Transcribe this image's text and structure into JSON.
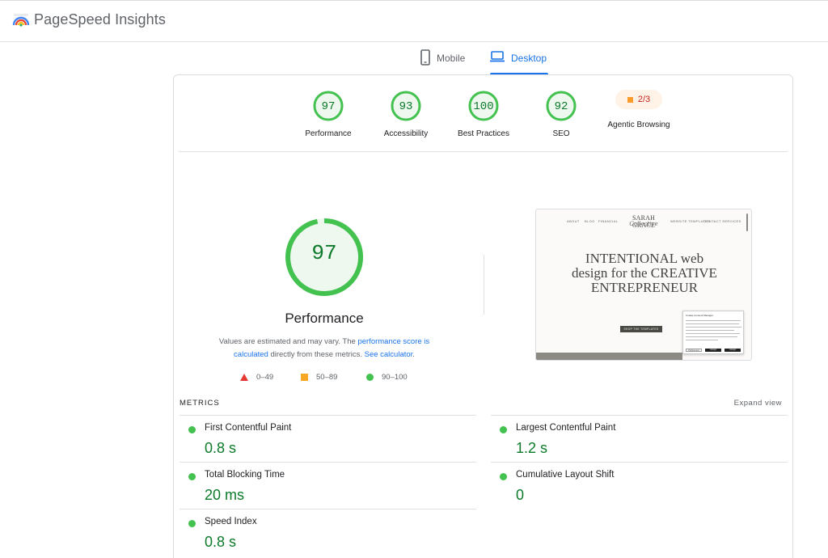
{
  "app": {
    "title": "PageSpeed Insights"
  },
  "tabs": [
    {
      "label": "Mobile",
      "icon": "phone-icon",
      "active": false
    },
    {
      "label": "Desktop",
      "icon": "laptop-icon",
      "active": true
    }
  ],
  "categories": [
    {
      "label": "Performance",
      "score": "97"
    },
    {
      "label": "Accessibility",
      "score": "93"
    },
    {
      "label": "Best Practices",
      "score": "100"
    },
    {
      "label": "SEO",
      "score": "92"
    },
    {
      "label": "Agentic Browsing",
      "score": "2/3"
    }
  ],
  "main": {
    "score": "97",
    "title": "Performance",
    "note_1": "Values are estimated and may vary. The ",
    "note_link_1": "performance score is calculated",
    "note_2": " directly from these metrics. ",
    "note_link_2": "See calculator",
    "note_3": "."
  },
  "legend": [
    {
      "range": "0–49",
      "shape": "triangle",
      "color": "#e53935"
    },
    {
      "range": "50–89",
      "shape": "square",
      "color": "#f9a825"
    },
    {
      "range": "90–100",
      "shape": "circle",
      "color": "#43c24f"
    }
  ],
  "screenshot": {
    "nav": [
      "ABOUT",
      "BLOG",
      "FINANCIAL",
      "WEBSITE TEMPLATES",
      "CONTACT SERVICES"
    ],
    "brand": "SARAH GRACE",
    "brand_script": "Collective",
    "hero_line1": "INTENTIONAL web",
    "hero_line2": "design for the CREATIVE",
    "hero_line3": "ENTREPRENEUR",
    "cta": "SHOP THE TEMPLATES",
    "cookie_title": "Cookie Consent Manager",
    "cookie_buttons": [
      "Preferences",
      "Accept",
      "Accept"
    ]
  },
  "metrics": {
    "header": "METRICS",
    "expand": "Expand view",
    "items": [
      {
        "name": "First Contentful Paint",
        "value": "0.8 s"
      },
      {
        "name": "Largest Contentful Paint",
        "value": "1.2 s"
      },
      {
        "name": "Total Blocking Time",
        "value": "20 ms"
      },
      {
        "name": "Cumulative Layout Shift",
        "value": "0"
      },
      {
        "name": "Speed Index",
        "value": "0.8 s"
      }
    ]
  },
  "colors": {
    "pass": "#0c7a2a",
    "pass_ring": "#43c24f",
    "accent": "#1a73e8",
    "warn": "#fa9c2c"
  }
}
